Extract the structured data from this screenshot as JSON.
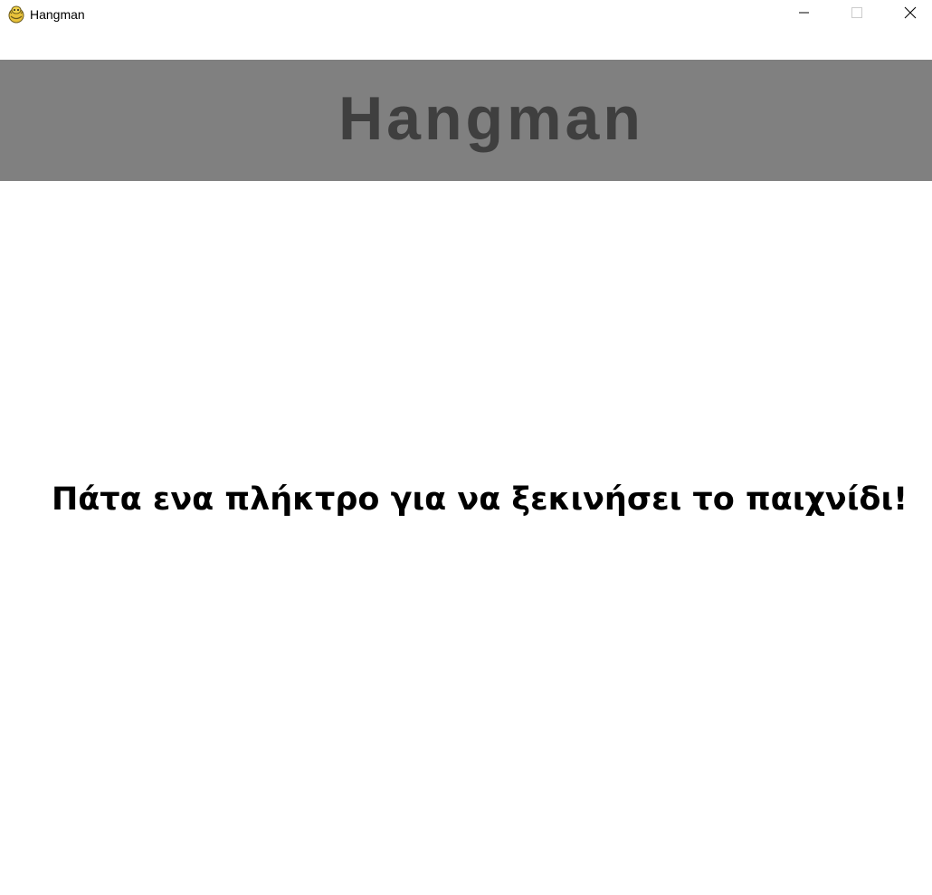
{
  "window": {
    "title": "Hangman",
    "icon": "pygame-snake-icon",
    "controls": {
      "minimize_icon": "minimize-icon",
      "maximize_icon": "maximize-icon",
      "close_icon": "close-icon"
    }
  },
  "game": {
    "title": "Hangman",
    "prompt": "Πάτα ενα πλήκτρο για να ξεκινήσει το παιχνίδι!",
    "colors": {
      "header_band": "#808080",
      "title_text": "#3f3f3f",
      "background": "#ffffff",
      "prompt_text": "#000000"
    }
  }
}
